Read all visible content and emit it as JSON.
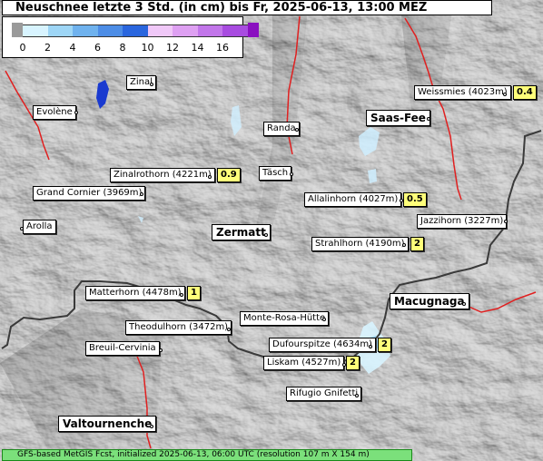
{
  "title": "Neuschnee letzte 3 Std. (in cm) bis Fr, 2025-06-13, 13:00 MEZ",
  "legend": {
    "ticks": [
      "0",
      "2",
      "4",
      "6",
      "8",
      "10",
      "12",
      "14",
      "16"
    ],
    "colors": [
      "#d8f4ff",
      "#9ed6f6",
      "#6fb2ee",
      "#4d8de6",
      "#2a66de",
      "#f0c8f8",
      "#dea0f2",
      "#c276ea",
      "#a84ce0"
    ],
    "below_color": "#9a9a9a",
    "above_color": "#8a10c0"
  },
  "places": [
    {
      "id": "zinal",
      "name": "Zinal",
      "big": false
    },
    {
      "id": "evolene",
      "name": "Evolène",
      "big": false
    },
    {
      "id": "randa",
      "name": "Randa",
      "big": false
    },
    {
      "id": "tasch",
      "name": "Täsch",
      "big": false
    },
    {
      "id": "saas-fee",
      "name": "Saas-Fee",
      "big": true
    },
    {
      "id": "weissmies",
      "name": "Weissmies (4023m)",
      "big": false,
      "value": "0.4"
    },
    {
      "id": "zinalrothorn",
      "name": "Zinalrothorn (4221m)",
      "big": false,
      "value": "0.9"
    },
    {
      "id": "grand-cornier",
      "name": "Grand Cornier (3969m)",
      "big": false
    },
    {
      "id": "allalinhorn",
      "name": "Allalinhorn (4027m)",
      "big": false,
      "value": "0.5"
    },
    {
      "id": "arolla",
      "name": "Arolla",
      "big": false
    },
    {
      "id": "zermatt",
      "name": "Zermatt",
      "big": true
    },
    {
      "id": "jazzihorn",
      "name": "Jazzihorn (3227m)",
      "big": false
    },
    {
      "id": "strahlhorn",
      "name": "Strahlhorn (4190m)",
      "big": false,
      "value": "2"
    },
    {
      "id": "matterhorn",
      "name": "Matterhorn (4478m)",
      "big": false,
      "value": "1"
    },
    {
      "id": "macugnaga",
      "name": "Macugnaga",
      "big": true
    },
    {
      "id": "monte-rosa-huette",
      "name": "Monte-Rosa-Hütte",
      "big": false
    },
    {
      "id": "theodulhorn",
      "name": "Theodulhorn (3472m)",
      "big": false
    },
    {
      "id": "breuil-cervinia",
      "name": "Breuil-Cervinia",
      "big": false
    },
    {
      "id": "dufourspitze",
      "name": "Dufourspitze (4634m)",
      "big": false,
      "value": "2"
    },
    {
      "id": "liskam",
      "name": "Liskam (4527m)",
      "big": false,
      "value": "2"
    },
    {
      "id": "rifugio-gnifetti",
      "name": "Rifugio Gnifetti",
      "big": false
    },
    {
      "id": "valtournenche",
      "name": "Valtournenche",
      "big": true
    }
  ],
  "footer": "GFS-based MetGIS Fcst, initialized 2025-06-13, 06:00 UTC  (resolution 107 m X 154 m)"
}
